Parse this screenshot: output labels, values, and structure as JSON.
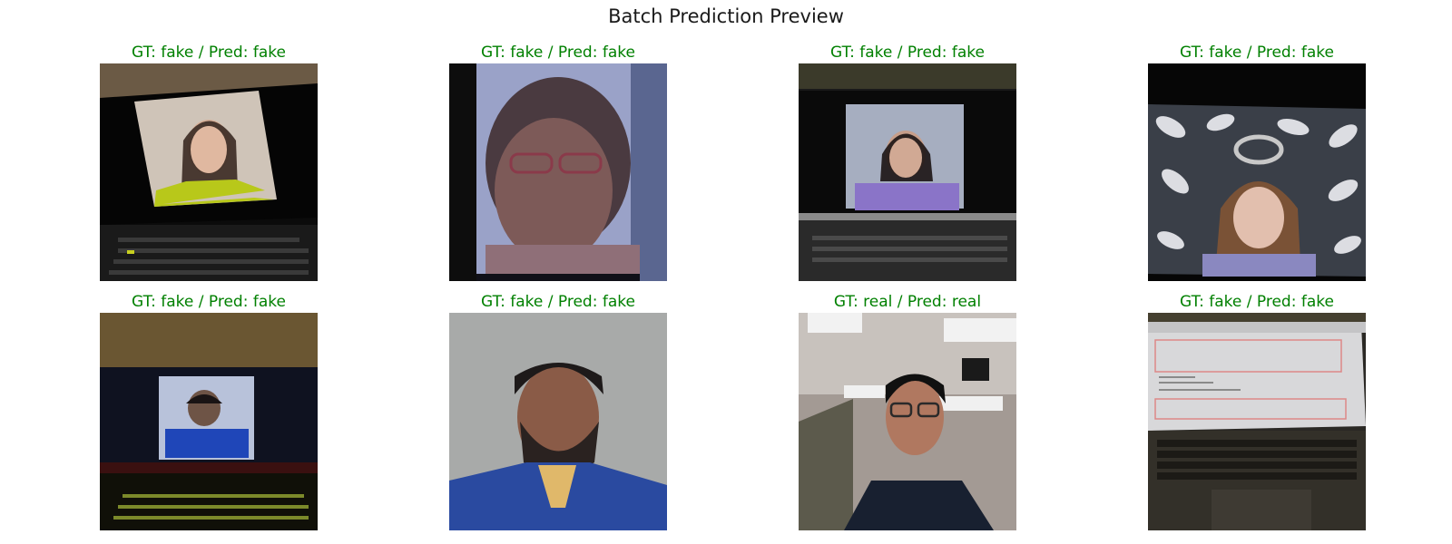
{
  "figure": {
    "title": "Batch Prediction Preview"
  },
  "colors": {
    "caption": "#008000",
    "background": "#ffffff"
  },
  "panels": [
    {
      "caption": "GT: fake / Pred: fake",
      "gt": "fake",
      "pred": "fake",
      "image": "woman on laptop screen"
    },
    {
      "caption": "GT: fake / Pred: fake",
      "gt": "fake",
      "pred": "fake",
      "image": "close-up woman with glasses on phone screen"
    },
    {
      "caption": "GT: fake / Pred: fake",
      "gt": "fake",
      "pred": "fake",
      "image": "woman in purple top on laptop screen"
    },
    {
      "caption": "GT: fake / Pred: fake",
      "gt": "fake",
      "pred": "fake",
      "image": "woman against leaf-pattern background"
    },
    {
      "caption": "GT: fake / Pred: fake",
      "gt": "fake",
      "pred": "fake",
      "image": "man in blue shirt on laptop screen"
    },
    {
      "caption": "GT: fake / Pred: fake",
      "gt": "fake",
      "pred": "fake",
      "image": "bearded man in blue polo"
    },
    {
      "caption": "GT: real / Pred: real",
      "gt": "real",
      "pred": "real",
      "image": "man with glasses in office room"
    },
    {
      "caption": "GT: fake / Pred: fake",
      "gt": "fake",
      "pred": "fake",
      "image": "laptop showing document"
    }
  ]
}
